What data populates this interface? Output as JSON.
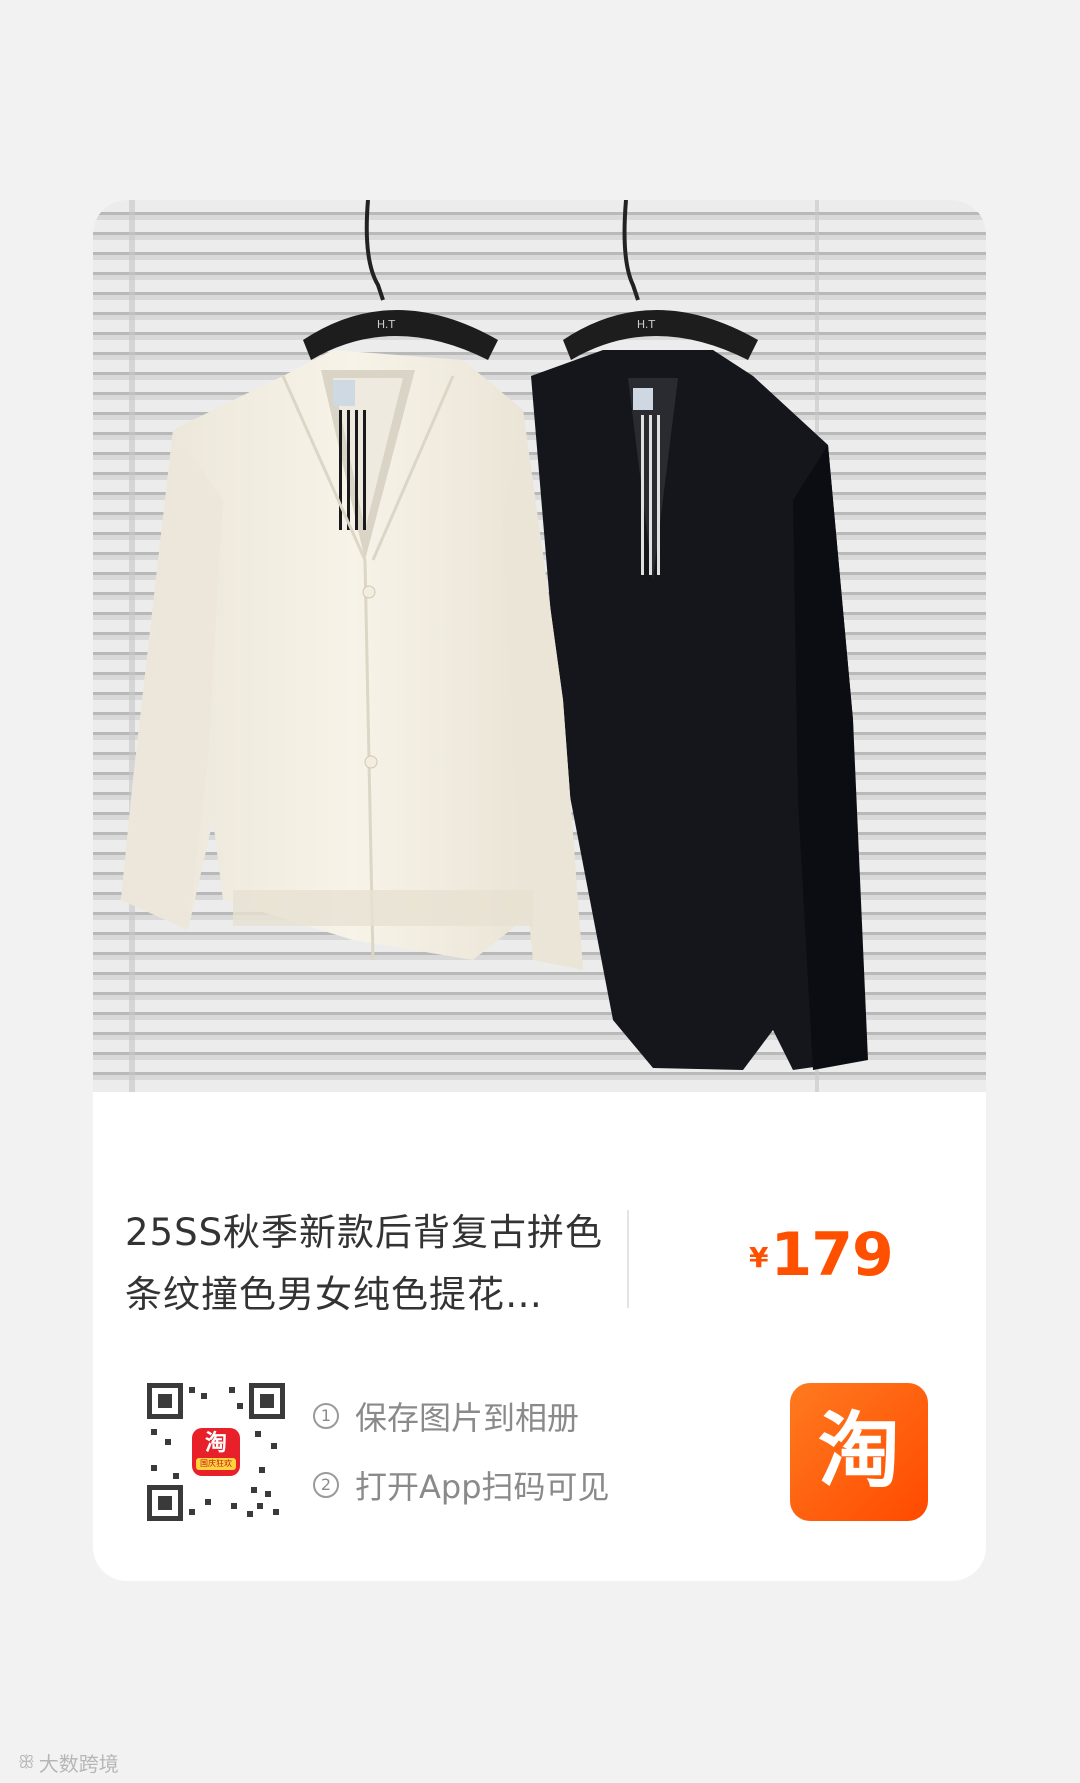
{
  "product": {
    "title": "25SS秋季新款后背复古拼色条纹撞色男女纯色提花…",
    "currency_symbol": "¥",
    "price": "179",
    "hanger_label": "H.T",
    "garments": [
      "cream v-neck cardigan",
      "black v-neck cardigan"
    ]
  },
  "share": {
    "step1_number": "①",
    "step1_text": "保存图片到相册",
    "step2_number": "②",
    "step2_text": "打开App扫码可见",
    "qr_badge_glyph": "淘",
    "qr_badge_sub": "国庆狂欢"
  },
  "app_logo": {
    "glyph": "淘",
    "name": "Taobao"
  },
  "watermark": {
    "logo": "ꕥ",
    "text": "大数跨境"
  },
  "colors": {
    "price": "#ff5000",
    "logo_bg": "#ff5a0a",
    "page_bg": "#f2f2f2",
    "card_bg": "#ffffff"
  }
}
